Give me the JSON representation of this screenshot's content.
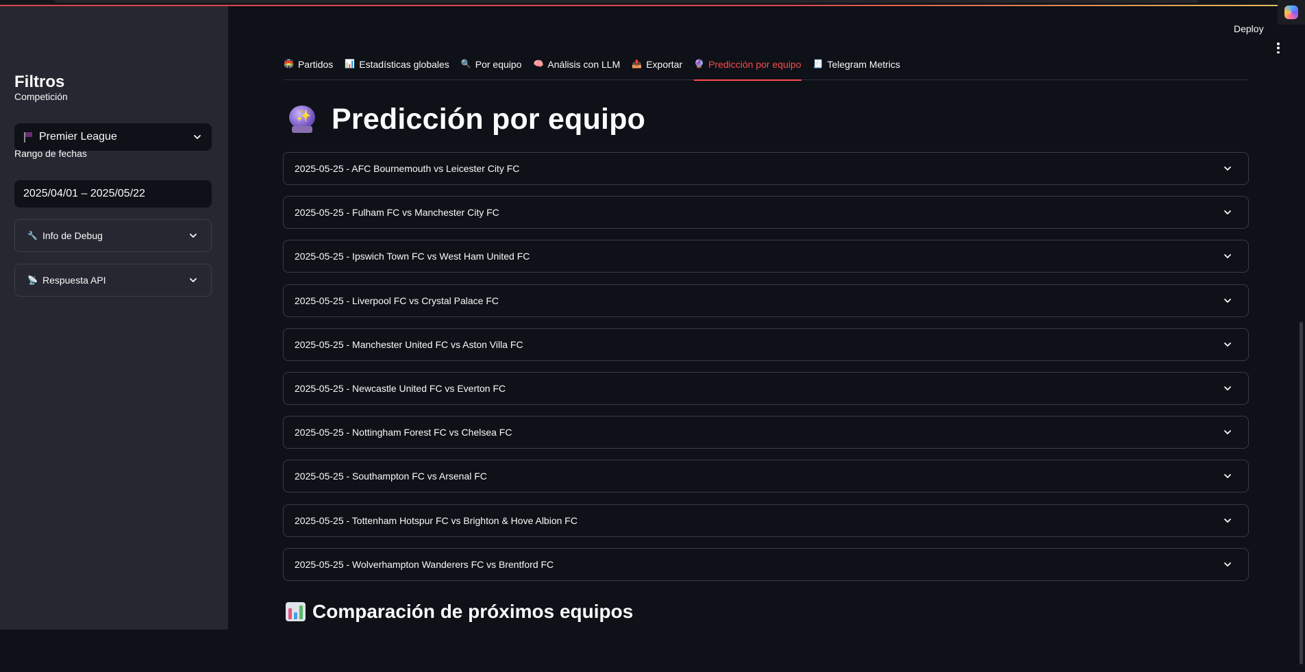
{
  "header": {
    "deploy_label": "Deploy"
  },
  "sidebar": {
    "title": "Filtros",
    "competition_label": "Competición",
    "competition_value": "Premier League",
    "date_range_label": "Rango de fechas",
    "date_range_value": "2025/04/01 – 2025/05/22",
    "expanders": [
      {
        "label": "Info de Debug",
        "icon": "wrench-icon"
      },
      {
        "label": "Respuesta API",
        "icon": "satellite-icon"
      }
    ]
  },
  "tabs": [
    {
      "label": "Partidos",
      "icon": "stadium-icon",
      "active": false
    },
    {
      "label": "Estadísticas globales",
      "icon": "bar-chart-icon",
      "active": false
    },
    {
      "label": "Por equipo",
      "icon": "magnifier-icon",
      "active": false
    },
    {
      "label": "Análisis con LLM",
      "icon": "brain-icon",
      "active": false
    },
    {
      "label": "Exportar",
      "icon": "outbox-icon",
      "active": false
    },
    {
      "label": "Predicción por equipo",
      "icon": "crystal-ball-icon",
      "active": true
    },
    {
      "label": "Telegram Metrics",
      "icon": "receipt-icon",
      "active": false
    }
  ],
  "main": {
    "title": "Predicción por equipo",
    "matches": [
      "2025-05-25 - AFC Bournemouth vs Leicester City FC",
      "2025-05-25 - Fulham FC vs Manchester City FC",
      "2025-05-25 - Ipswich Town FC vs West Ham United FC",
      "2025-05-25 - Liverpool FC vs Crystal Palace FC",
      "2025-05-25 - Manchester United FC vs Aston Villa FC",
      "2025-05-25 - Newcastle United FC vs Everton FC",
      "2025-05-25 - Nottingham Forest FC vs Chelsea FC",
      "2025-05-25 - Southampton FC vs Arsenal FC",
      "2025-05-25 - Tottenham Hotspur FC vs Brighton & Hove Albion FC",
      "2025-05-25 - Wolverhampton Wanderers FC vs Brentford FC"
    ],
    "section_title": "Comparación de próximos equipos"
  },
  "colors": {
    "background": "#0e1117",
    "sidebar": "#262730",
    "accent": "#ff4b4b",
    "text": "#fafafa",
    "border": "#3a3c45"
  }
}
